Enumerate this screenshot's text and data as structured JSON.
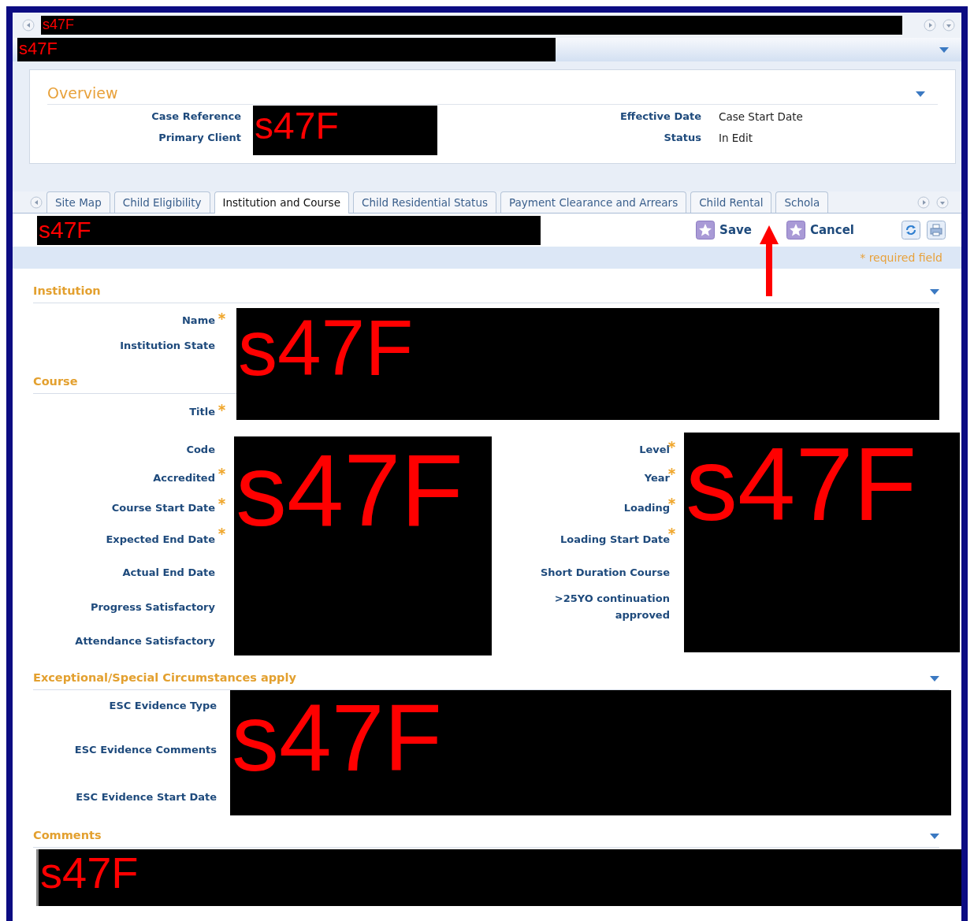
{
  "top_strip": {
    "redacted": "s47F"
  },
  "title_bar": {
    "redacted": "s47F"
  },
  "overview": {
    "title": "Overview",
    "left_labels": [
      "Case Reference",
      "Primary Client"
    ],
    "left_redacted": "s47F",
    "right_fields": [
      {
        "label": "Effective Date",
        "value": "Case Start Date"
      },
      {
        "label": "Status",
        "value": "In Edit"
      }
    ]
  },
  "tabs": [
    {
      "label": "Site Map",
      "selected": false
    },
    {
      "label": "Child Eligibility",
      "selected": false
    },
    {
      "label": "Institution and Course",
      "selected": true
    },
    {
      "label": "Child Residential Status",
      "selected": false
    },
    {
      "label": "Payment Clearance and Arrears",
      "selected": false
    },
    {
      "label": "Child Rental",
      "selected": false
    },
    {
      "label": "Schola",
      "selected": false
    }
  ],
  "toolbar": {
    "redacted": "s47F",
    "buttons": [
      "Save",
      "Cancel"
    ]
  },
  "required_note": "* required field",
  "institution_course": {
    "redacted": "s47F",
    "sections": [
      {
        "title": "Institution",
        "fields": [
          {
            "label": "Name",
            "required": true
          },
          {
            "label": "Institution State",
            "required": false
          }
        ]
      },
      {
        "title": "Course",
        "fields": [
          {
            "label": "Title",
            "required": true
          }
        ]
      }
    ]
  },
  "course_details": {
    "left": {
      "redacted": "s47F",
      "fields": [
        {
          "label": "Code",
          "required": false
        },
        {
          "label": "Accredited",
          "required": true
        },
        {
          "label": "Course Start Date",
          "required": true
        },
        {
          "label": "Expected End Date",
          "required": true
        },
        {
          "label": "Actual End Date",
          "required": false
        },
        {
          "label": "Progress Satisfactory",
          "required": false
        },
        {
          "label": "Attendance Satisfactory",
          "required": false
        }
      ]
    },
    "right": {
      "redacted": "s47F",
      "fields": [
        {
          "label": "Level",
          "required": true
        },
        {
          "label": "Year",
          "required": true
        },
        {
          "label": "Loading",
          "required": true
        },
        {
          "label": "Loading Start Date",
          "required": true
        },
        {
          "label": "Short Duration Course",
          "required": false
        },
        {
          "label": ">25YO continuation approved",
          "required": false
        }
      ]
    }
  },
  "esc": {
    "title": "Exceptional/Special Circumstances apply",
    "redacted": "s47F",
    "fields": [
      {
        "label": "ESC Evidence Type"
      },
      {
        "label": "ESC Evidence Comments"
      },
      {
        "label": "ESC Evidence Start Date"
      }
    ]
  },
  "comments": {
    "title": "Comments",
    "redacted": "s47F"
  }
}
